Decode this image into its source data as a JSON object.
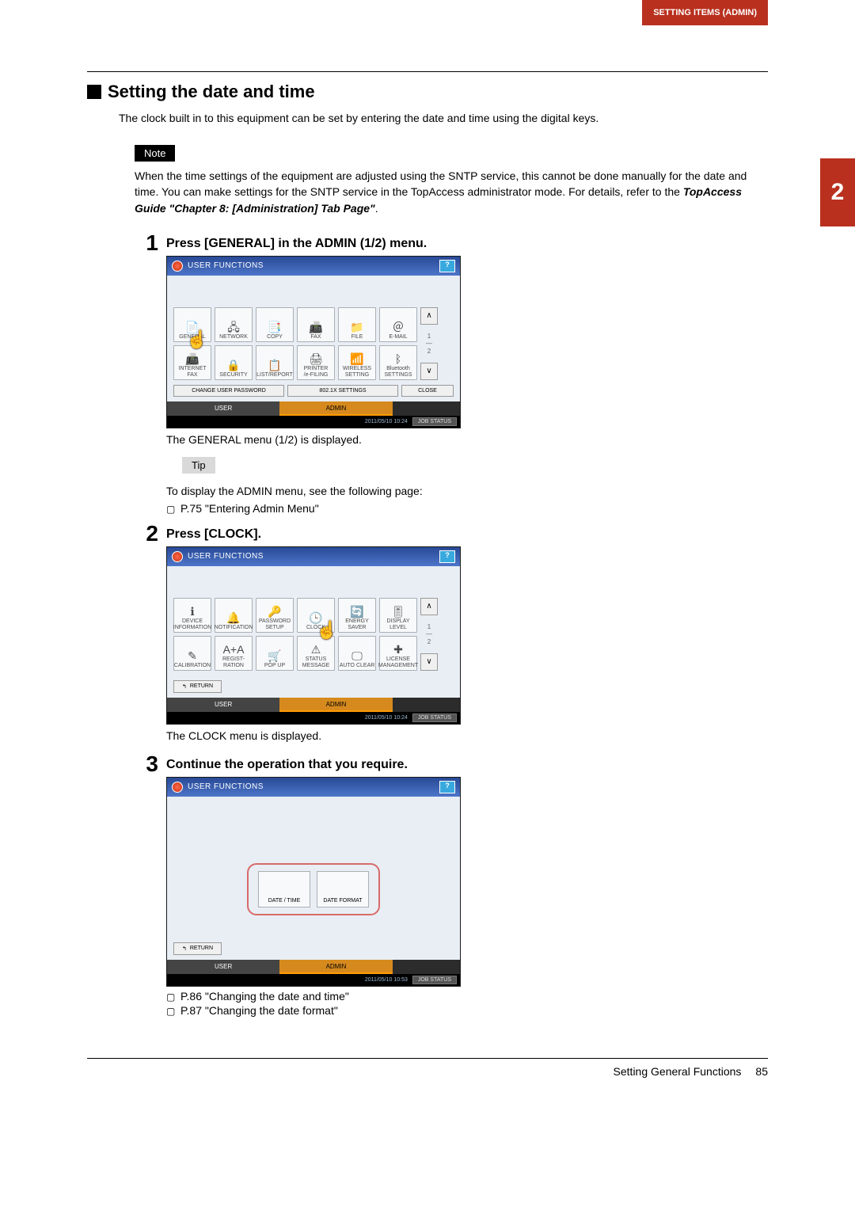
{
  "header": {
    "top_tab": "SETTING ITEMS (ADMIN)",
    "side_tab": "2"
  },
  "section": {
    "title": "Setting the date and time",
    "intro": "The clock built in to this equipment can be set by entering the date and time using the digital keys."
  },
  "note": {
    "label": "Note",
    "body_1": "When the time settings of the equipment are adjusted using the SNTP service, this cannot be done manually for the date and time. You can make settings for the SNTP service in the TopAccess administrator mode. For details, refer to the ",
    "body_bold": "TopAccess Guide \"Chapter 8: [Administration] Tab Page\"",
    "body_2": "."
  },
  "steps": {
    "s1": {
      "num": "1",
      "title": "Press [GENERAL] in the ADMIN (1/2) menu.",
      "after": "The GENERAL menu (1/2) is displayed.",
      "tip_label": "Tip",
      "tip_line1": "To display the ADMIN menu, see the following page:",
      "tip_ref": "P.75 \"Entering Admin Menu\""
    },
    "s2": {
      "num": "2",
      "title": "Press [CLOCK].",
      "after": "The CLOCK menu is displayed."
    },
    "s3": {
      "num": "3",
      "title": "Continue the operation that you require.",
      "ref1": "P.86 \"Changing the date and time\"",
      "ref2": "P.87 \"Changing the date format\""
    }
  },
  "panel": {
    "title": "USER FUNCTIONS",
    "help": "?",
    "tabs": {
      "user": "USER",
      "admin": "ADMIN"
    },
    "buttons": {
      "change_pw": "CHANGE USER PASSWORD",
      "x8021x": "802.1X SETTINGS",
      "close": "CLOSE",
      "return": "RETURN"
    },
    "scroll": {
      "up": "∧",
      "down": "∨",
      "frac": "1\n—\n2"
    },
    "status": {
      "dt": "2011/05/10\n10:24",
      "dt_alt": "2011/05/10\n10:53",
      "job": "JOB STATUS"
    },
    "grid1": {
      "r1": [
        "GENERAL",
        "NETWORK",
        "COPY",
        "FAX",
        "FILE",
        "E-MAIL"
      ],
      "r2": [
        "INTERNET\nFAX",
        "SECURITY",
        "LIST/REPORT",
        "PRINTER\n/e-FILING",
        "WIRELESS\nSETTING",
        "Bluetooth\nSETTINGS"
      ]
    },
    "grid2": {
      "r1": [
        "DEVICE\nINFORMATION",
        "NOTIFICATION",
        "PASSWORD\nSETUP",
        "CLOCK",
        "ENERGY\nSAVER",
        "DISPLAY\nLEVEL"
      ],
      "r2": [
        "CALIBRATION",
        "REGIST-\nRATION",
        "POP UP",
        "STATUS\nMESSAGE",
        "AUTO CLEAR",
        "LICENSE\nMANAGEMENT"
      ]
    },
    "grid3": {
      "date_time": "DATE / TIME",
      "date_format": "DATE FORMAT"
    }
  },
  "icons_hints": {
    "grid1_r1": [
      "📄",
      "🖧",
      "📑",
      "📠",
      "📁",
      "＠"
    ],
    "grid1_r2": [
      "📠",
      "🔒",
      "📋",
      "🖨",
      "📶",
      "ᛒ"
    ],
    "grid2_r1": [
      "ℹ",
      "🔔",
      "🔑",
      "🕒",
      "🔄",
      "🎚"
    ],
    "grid2_r2": [
      "✎",
      "A+A",
      "🛒",
      "⚠",
      "🖵",
      "✚"
    ]
  },
  "footer": {
    "section": "Setting General Functions",
    "page": "85"
  }
}
